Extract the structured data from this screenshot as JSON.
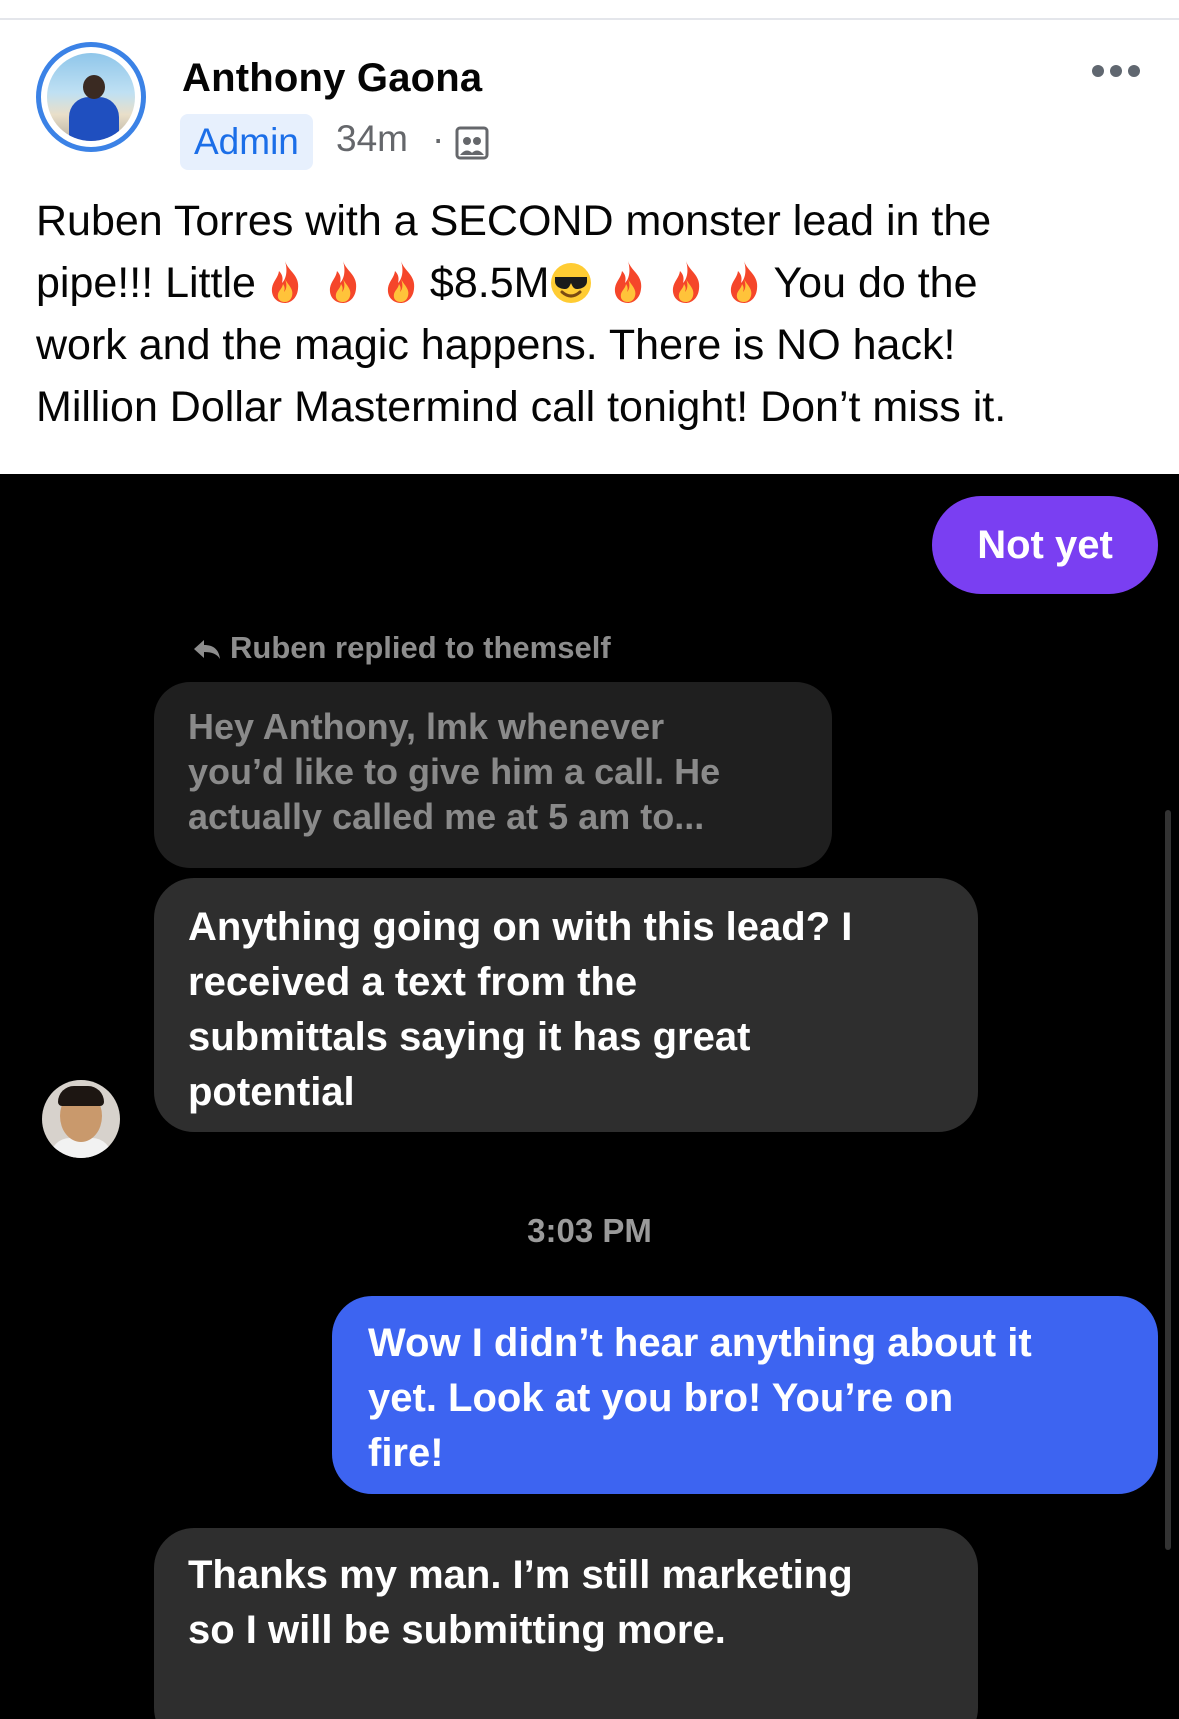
{
  "post": {
    "author": "Anthony Gaona",
    "badge": "Admin",
    "time": "34m",
    "dot": "·",
    "text_line1": "Ruben Torres with a SECOND monster lead in the",
    "text_line2_a": "pipe!!! Little",
    "text_line2_b": "$8.5M",
    "text_line2_c": "You do the",
    "text_line3": "work and the magic happens. There is NO hack!",
    "text_line4": "Million Dollar Mastermind call tonight! Don’t miss it.",
    "icons": [
      "fire-emoji",
      "smiling-face-with-sunglasses-emoji",
      "group-privacy-icon",
      "more-options-icon"
    ]
  },
  "screenshot": {
    "msg_not_yet": "Not yet",
    "reply_label": "Ruben replied to themself",
    "reply_quote": [
      "Hey Anthony, lmk whenever",
      "you’d like to give him a call. He",
      "actually called me at 5 am to..."
    ],
    "msg_ruben_1": [
      "Anything going on with this lead? I",
      "received a text from the",
      "submittals saying it has great",
      "potential"
    ],
    "timestamp": "3:03 PM",
    "msg_anthony": [
      "Wow I didn’t hear anything about it",
      "yet. Look at you bro! You’re on",
      "fire!"
    ],
    "msg_ruben_2": [
      "Thanks my man. I’m still marketing",
      "so I will be submitting more."
    ],
    "colors": {
      "purple_bubble": "#7a3ff2",
      "blue_bubble": "#3d64f1",
      "gray_bubble": "#2e2e2e",
      "admin_badge": "#e7f0fd",
      "admin_text": "#1b6ee8"
    }
  }
}
